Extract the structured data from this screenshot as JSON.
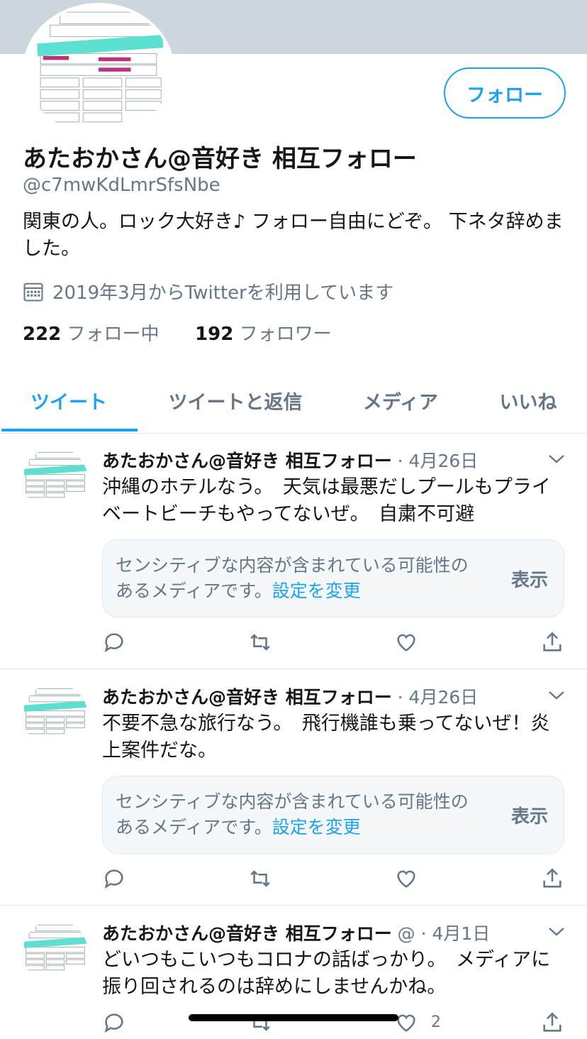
{
  "profile": {
    "name": "あたおかさん@音好き 相互フォロー",
    "handle": "@c7mwKdLmrSfsNbe",
    "bio": "関東の人。ロック大好き♪ フォロー自由にどぞ。 下ネタ辞めました。",
    "joined": "2019年3月からTwitterを利用しています",
    "following_count": "222",
    "following_label": "フォロー中",
    "followers_count": "192",
    "followers_label": "フォロワー",
    "follow_button": "フォロー"
  },
  "tabs": [
    {
      "label": "ツイート"
    },
    {
      "label": "ツイートと返信"
    },
    {
      "label": "メディア"
    },
    {
      "label": "いいね"
    }
  ],
  "tweets": [
    {
      "name": "あたおかさん@音好き 相互フォロー",
      "meta": " · 4月26日",
      "text": "沖縄のホテルなう。　天気は最悪だしプールもプライベートビーチもやってないぜ。　自粛不可避",
      "sensitive_text": "センシティブな内容が含まれている可能性のあるメディアです。",
      "sensitive_link": "設定を変更",
      "show_label": "表示"
    },
    {
      "name": "あたおかさん@音好き 相互フォロー",
      "meta": " · 4月26日",
      "text": "不要不急な旅行なう。　飛行機誰も乗ってないぜ！炎上案件だな。",
      "sensitive_text": "センシティブな内容が含まれている可能性のあるメディアです。",
      "sensitive_link": "設定を変更",
      "show_label": "表示"
    },
    {
      "name": "あたおかさん@音好き 相互フォロー",
      "meta": " @ · 4月1日",
      "text": "どいつもこいつもコロナの話ばっかり。　メディアに振り回されるのは辞めにしませんかね。",
      "like_count": "2"
    }
  ],
  "colors": {
    "accent": "#1da1f2",
    "muted": "#657786",
    "banner": "#ccd6dd",
    "border": "#e1e8ed"
  },
  "icons": [
    "calendar-icon",
    "reply-icon",
    "retweet-icon",
    "like-icon",
    "share-icon",
    "chevron-down-icon"
  ]
}
